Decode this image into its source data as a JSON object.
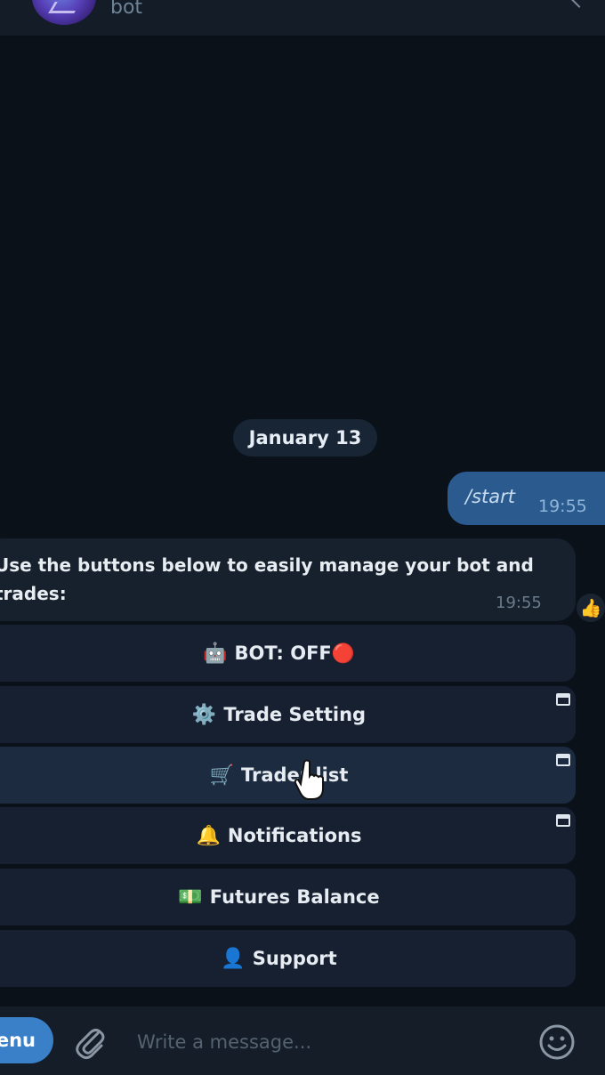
{
  "header": {
    "subtitle": "bot",
    "avatar_icon": "bot-logo-icon"
  },
  "chat": {
    "date_separator": "January 13",
    "outgoing": {
      "text": "/start",
      "time": "19:55"
    },
    "incoming": {
      "text": "Use the buttons below to easily manage your bot and trades:",
      "time": "19:55",
      "reaction": "👍"
    }
  },
  "keyboard": {
    "buttons": [
      {
        "icon": "🤖",
        "label": "BOT: OFF🔴",
        "popup": false
      },
      {
        "icon": "⚙️",
        "label": "Trade Setting",
        "popup": true
      },
      {
        "icon": "🛒",
        "label": "Trader list",
        "popup": true
      },
      {
        "icon": "🔔",
        "label": "Notifications",
        "popup": true
      },
      {
        "icon": "💵",
        "label": "Futures Balance",
        "popup": false
      },
      {
        "icon": "👤",
        "label": "Support",
        "popup": false
      }
    ]
  },
  "input_bar": {
    "menu_label": "Menu",
    "placeholder": "Write a message...",
    "attach_icon": "paperclip-icon",
    "emoji_icon": "smile-icon"
  },
  "colors": {
    "background": "#0b1119",
    "bubble_in": "#17212d",
    "bubble_out": "#2b5a8e",
    "accent": "#3a80c9"
  }
}
